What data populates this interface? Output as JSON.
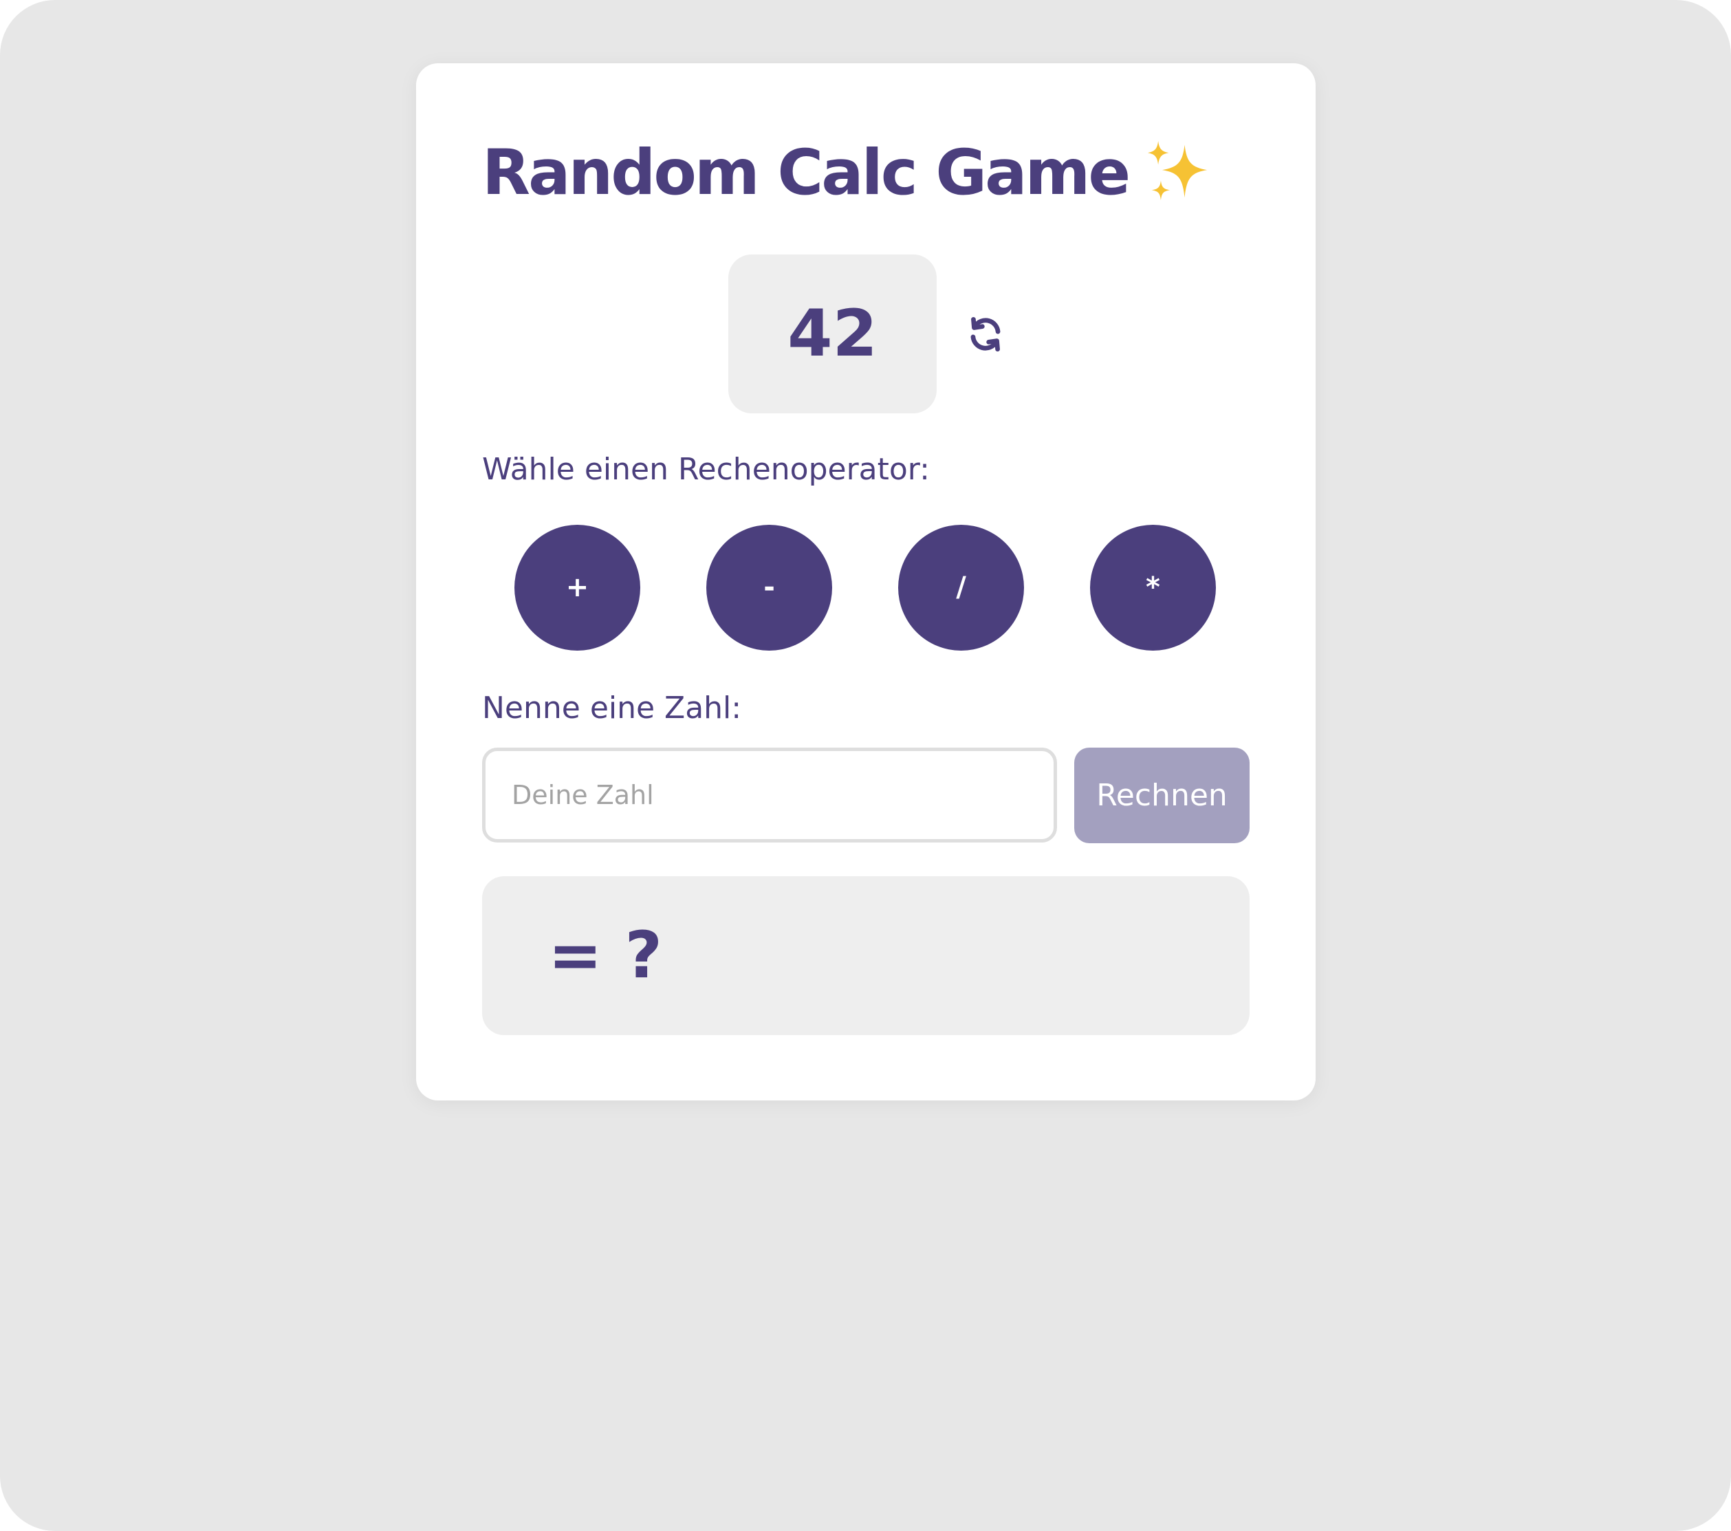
{
  "app": {
    "title": "Random Calc Game",
    "title_emoji_icon": "sparkles-icon"
  },
  "random_number": {
    "value": "42",
    "refresh_icon": "refresh-icon"
  },
  "operators": {
    "label": "Wähle einen Rechenoperator:",
    "items": [
      {
        "symbol": "+"
      },
      {
        "symbol": "-"
      },
      {
        "symbol": "/"
      },
      {
        "symbol": "*"
      }
    ]
  },
  "number_input": {
    "label": "Nenne eine Zahl:",
    "placeholder": "Deine Zahl",
    "value": ""
  },
  "calculate_button": {
    "label": "Rechnen"
  },
  "result": {
    "text": "= ?"
  },
  "colors": {
    "accent": "#4b3f7d",
    "button_disabled": "#a3a0bf",
    "panel_background": "#eeeeee",
    "page_background": "#e7e7e7",
    "card_background": "#ffffff",
    "sparkle": "#f6c234"
  }
}
